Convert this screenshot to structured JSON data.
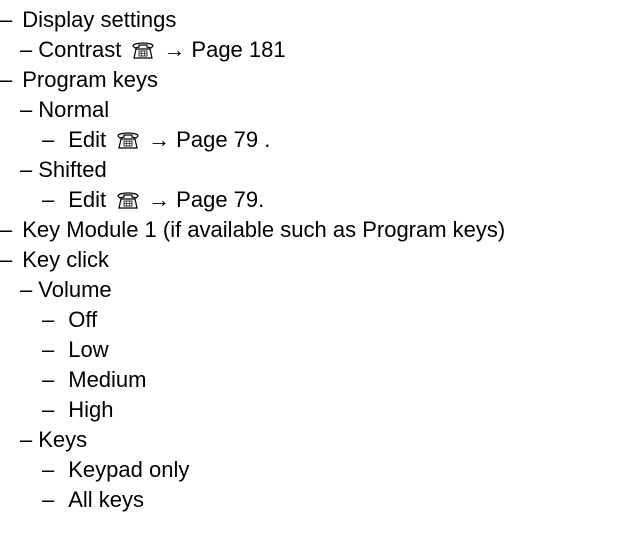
{
  "dash": "–",
  "arrow": "→",
  "icon": "phone-keypad-icon",
  "items": {
    "display_settings": "Display settings",
    "contrast": "Contrast",
    "contrast_ref": "Page 181",
    "program_keys": "Program keys",
    "normal": "Normal",
    "edit_normal": "Edit",
    "edit_normal_ref": "Page 79 .",
    "shifted": "Shifted",
    "edit_shifted": "Edit",
    "edit_shifted_ref": "Page 79.",
    "key_module": "Key Module 1 (if available such as Program keys)",
    "key_click": "Key click",
    "volume": "Volume",
    "off": "Off",
    "low": "Low",
    "medium": "Medium",
    "high": "High",
    "keys": "Keys",
    "keypad_only": "Keypad only",
    "all_keys": "All keys"
  }
}
